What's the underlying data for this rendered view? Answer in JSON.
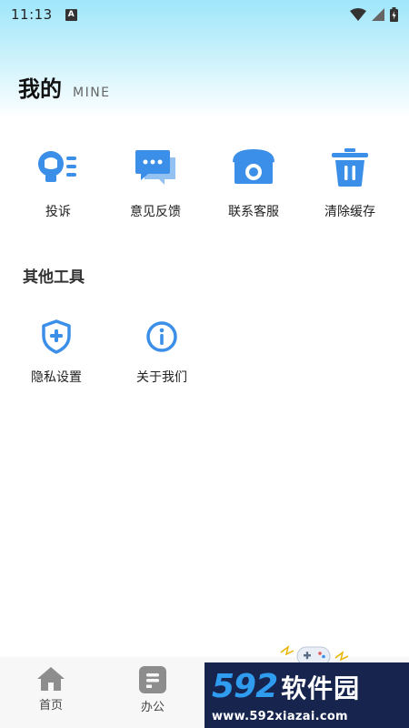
{
  "status_bar": {
    "time": "11:13",
    "notification_icon": "a-letter-icon",
    "icons": [
      "wifi-icon",
      "signal-icon",
      "battery-icon"
    ]
  },
  "header": {
    "title": "我的",
    "subtitle": "MINE"
  },
  "main_actions": [
    {
      "label": "投诉",
      "icon": "complaint-icon"
    },
    {
      "label": "意见反馈",
      "icon": "feedback-chat-icon"
    },
    {
      "label": "联系客服",
      "icon": "phone-icon"
    },
    {
      "label": "清除缓存",
      "icon": "trash-icon"
    }
  ],
  "other_tools": {
    "title": "其他工具",
    "items": [
      {
        "label": "隐私设置",
        "icon": "shield-plus-icon"
      },
      {
        "label": "关于我们",
        "icon": "info-icon"
      }
    ]
  },
  "tabbar": {
    "tabs": [
      {
        "label": "首页",
        "icon": "home-icon"
      },
      {
        "label": "办公",
        "icon": "office-doc-icon"
      }
    ]
  },
  "watermark": {
    "number": "592",
    "brand": "软件园",
    "url": "www.592xiazai.com"
  },
  "colors": {
    "accent": "#3b8fe8",
    "gradient_top": "#9fe6fb",
    "watermark_bg": "#17244e"
  }
}
